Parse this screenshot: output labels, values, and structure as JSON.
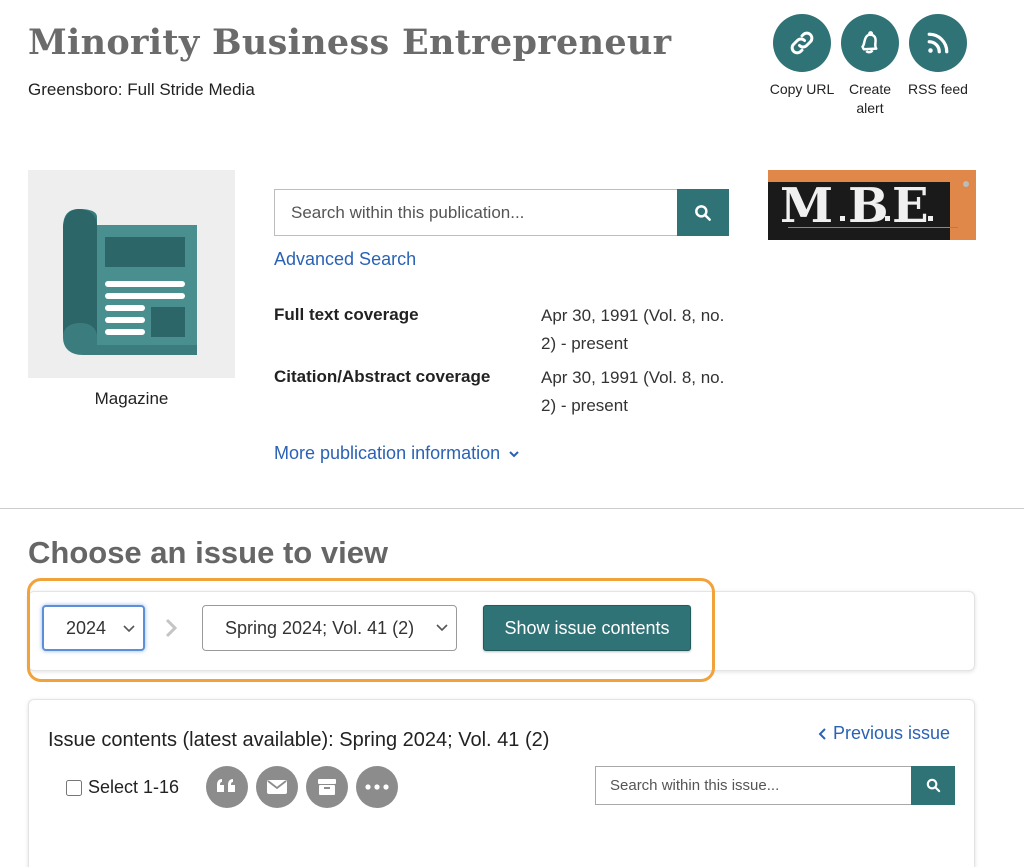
{
  "publication": {
    "title": "Minority Business Entrepreneur",
    "publisher": "Greensboro: Full Stride Media",
    "type_label": "Magazine",
    "logo_icon": "mbe-logo-image"
  },
  "actions": {
    "copy_url": "Copy URL",
    "create_alert": "Create\nalert",
    "rss_feed": "RSS feed"
  },
  "search": {
    "placeholder": "Search within this publication...",
    "advanced_link": "Advanced Search"
  },
  "coverage": {
    "full_text_label": "Full text coverage",
    "full_text_value": "Apr 30, 1991 (Vol. 8, no. 2) - present",
    "citation_label": "Citation/Abstract coverage",
    "citation_value": "Apr 30, 1991 (Vol. 8, no. 2) - present"
  },
  "more_info_link": "More publication information",
  "issue_chooser": {
    "heading": "Choose an issue to view",
    "year_selected": "2024",
    "issue_selected": "Spring 2024; Vol. 41 (2)",
    "show_button": "Show issue contents"
  },
  "issue_contents": {
    "title": "Issue contents (latest available): Spring 2024; Vol. 41 (2)",
    "previous_link": "Previous issue",
    "select_label": "Select 1-16",
    "search_placeholder": "Search within this issue..."
  },
  "colors": {
    "teal": "#2f7377",
    "link": "#2a62b5",
    "highlight": "#f2a23b",
    "gray_button": "#8c8c8c"
  }
}
